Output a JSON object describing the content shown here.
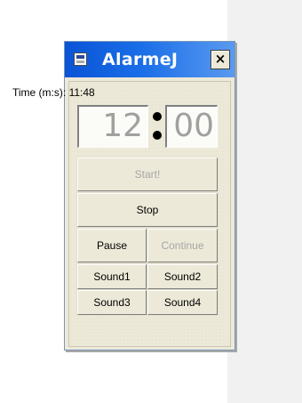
{
  "window": {
    "title": "AlarmeJ",
    "close_label": "×"
  },
  "timer": {
    "label": "Time (m:s):",
    "current": "11:48",
    "minutes": "12",
    "seconds": "00"
  },
  "buttons": {
    "start": "Start!",
    "stop": "Stop",
    "pause": "Pause",
    "continue": "Continue",
    "sound1": "Sound1",
    "sound2": "Sound2",
    "sound3": "Sound3",
    "sound4": "Sound4"
  },
  "colors": {
    "titlebar": "#0a54d6",
    "window_bg": "#ece9d8",
    "disabled_text": "#a6a6a6"
  }
}
